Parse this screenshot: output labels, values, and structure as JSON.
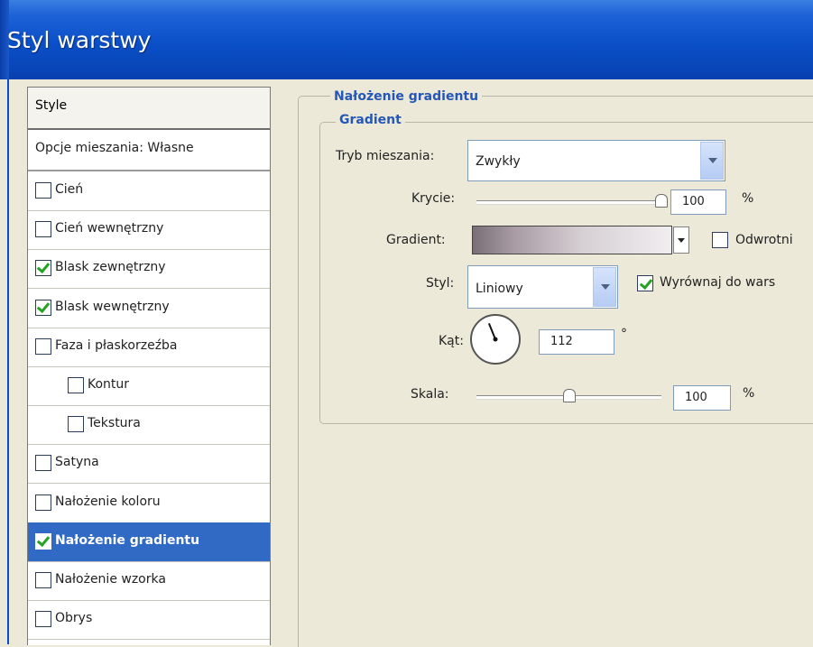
{
  "window": {
    "title": "Styl warstwy"
  },
  "styles_list": {
    "header": "Style",
    "blend_options": "Opcje mieszania: Własne",
    "items": [
      {
        "label": "Cień",
        "checked": false,
        "selected": false,
        "indent": false
      },
      {
        "label": "Cień wewnętrzny",
        "checked": false,
        "selected": false,
        "indent": false
      },
      {
        "label": "Blask zewnętrzny",
        "checked": true,
        "selected": false,
        "indent": false
      },
      {
        "label": "Blask wewnętrzny",
        "checked": true,
        "selected": false,
        "indent": false
      },
      {
        "label": "Faza i płaskorzeźba",
        "checked": false,
        "selected": false,
        "indent": false
      },
      {
        "label": "Kontur",
        "checked": false,
        "selected": false,
        "indent": true
      },
      {
        "label": "Tekstura",
        "checked": false,
        "selected": false,
        "indent": true
      },
      {
        "label": "Satyna",
        "checked": false,
        "selected": false,
        "indent": false
      },
      {
        "label": "Nałożenie koloru",
        "checked": false,
        "selected": false,
        "indent": false
      },
      {
        "label": "Nałożenie gradientu",
        "checked": true,
        "selected": true,
        "indent": false
      },
      {
        "label": "Nałożenie wzorka",
        "checked": false,
        "selected": false,
        "indent": false
      },
      {
        "label": "Obrys",
        "checked": false,
        "selected": false,
        "indent": false
      }
    ]
  },
  "panel": {
    "group_title": "Nałożenie gradientu",
    "subgroup_title": "Gradient",
    "blend_mode": {
      "label": "Tryb mieszania:",
      "value": "Zwykły"
    },
    "opacity": {
      "label": "Krycie:",
      "value": "100",
      "unit": "%",
      "level": 1.0
    },
    "gradient": {
      "label": "Gradient:",
      "reverse_label": "Odwrotni",
      "reverse_checked": false
    },
    "style": {
      "label": "Styl:",
      "value": "Liniowy",
      "align_label": "Wyrównaj do wars",
      "align_checked": true
    },
    "angle": {
      "label": "Kąt:",
      "value": "112",
      "unit": "°",
      "degrees": 112
    },
    "scale": {
      "label": "Skala:",
      "value": "100",
      "unit": "%",
      "level": 0.5
    }
  },
  "colors": {
    "title_bar": "#0a4fc7",
    "selection": "#316ac5",
    "group_title": "#2457b8",
    "check": "#24a323"
  }
}
